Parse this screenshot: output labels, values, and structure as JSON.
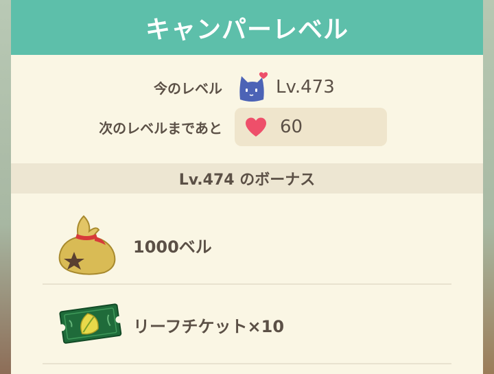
{
  "header": {
    "title": "キャンパーレベル"
  },
  "current_level": {
    "label": "今のレベル",
    "value": "Lv.473"
  },
  "next_level": {
    "label": "次のレベルまであと",
    "points": "60"
  },
  "bonus": {
    "title": "Lv.474 のボーナス"
  },
  "rewards": [
    {
      "label": "1000ベル",
      "icon": "bell-bag-icon"
    },
    {
      "label": "リーフチケット×10",
      "icon": "leaf-ticket-icon"
    }
  ],
  "colors": {
    "header": "#5dbfaa",
    "panel": "#faf6e4",
    "text": "#5b5046",
    "heart": "#ee4f6a",
    "cat": "#4c63b6"
  }
}
